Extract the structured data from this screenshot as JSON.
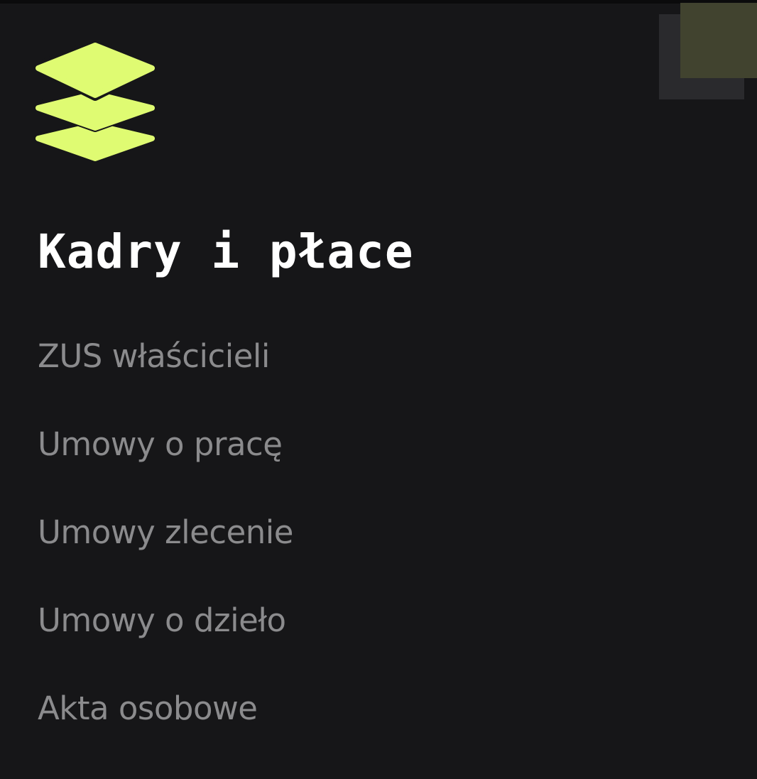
{
  "theme": {
    "background": "#161618",
    "accent": "#dffb72",
    "title_color": "#ffffff",
    "item_color": "#8b8b8d"
  },
  "logo": {
    "icon": "layers-icon"
  },
  "section": {
    "title": "Kadry i płace"
  },
  "menu": {
    "items": [
      {
        "label": "ZUS właścicieli"
      },
      {
        "label": "Umowy o pracę"
      },
      {
        "label": "Umowy zlecenie"
      },
      {
        "label": "Umowy o dzieło"
      },
      {
        "label": "Akta osobowe"
      }
    ]
  }
}
